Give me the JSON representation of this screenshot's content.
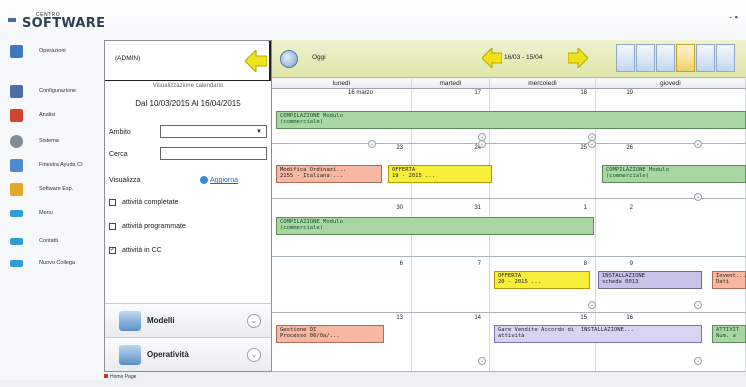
{
  "app": {
    "logo_line1": "CENTRO",
    "logo_line2": "SOFTWARE",
    "window_controls": "- ▪"
  },
  "nav": {
    "items": [
      {
        "label": "Operazioni",
        "icon": "stack-icon",
        "color": "#3e78c2"
      },
      {
        "label": "Configurazione",
        "icon": "tools-icon",
        "color": "#4c6ea8"
      },
      {
        "label": "Analisi",
        "icon": "chart-icon",
        "color": "#d0452e"
      },
      {
        "label": "Sistema",
        "icon": "gears-icon",
        "color": "#7f8c9a"
      },
      {
        "label": "Finestra Ayuda CI",
        "icon": "window-icon",
        "color": "#4d8ad1"
      },
      {
        "label": "Software Esp.",
        "icon": "box-icon",
        "color": "#e3a827"
      },
      {
        "label": "Menu",
        "icon": "arrow-icon",
        "color": "#2f9ed6"
      },
      {
        "label": "Contatti",
        "icon": "arrow-icon",
        "color": "#2f9ed6"
      },
      {
        "label": "Nuovo Collega",
        "icon": "arrow-icon",
        "color": "#2f9ed6"
      }
    ]
  },
  "panel": {
    "user": "(ADMIN)",
    "subtitle": "Visualizzazione calendario",
    "date_range": "Dal 10/03/2015 Al 16/04/2015",
    "ambito_label": "Ambito",
    "ambito_value": "",
    "cerca_label": "Cerca",
    "cerca_value": "",
    "visualizza_label": "Visualizza",
    "refresh_label": "Aggiorna",
    "checks": [
      {
        "label": "attività completate",
        "checked": false
      },
      {
        "label": "attività programmate",
        "checked": false
      },
      {
        "label": "attività in CC",
        "checked": true
      }
    ],
    "sections": [
      {
        "label": "Modelli",
        "icon": "document-icon"
      },
      {
        "label": "Operatività",
        "icon": "document-icon"
      }
    ]
  },
  "status": {
    "text": "Home Page"
  },
  "toolbar": {
    "today_label": "Oggi",
    "range_label": "16/03 - 15/04"
  },
  "calendar": {
    "days": [
      "lunedì",
      "martedì",
      "mercoledì",
      "giovedì"
    ],
    "weeks": [
      {
        "nums": [
          "16 marzo",
          "17",
          "18",
          "19"
        ]
      },
      {
        "nums": [
          "23",
          "24",
          "25",
          "26"
        ]
      },
      {
        "nums": [
          "30",
          "31",
          "1",
          "2"
        ]
      },
      {
        "nums": [
          "6",
          "7",
          "8",
          "9"
        ]
      },
      {
        "nums": [
          "13",
          "14",
          "15",
          "16"
        ]
      }
    ],
    "events": [
      {
        "text": "COMPILAZIONE Modulo\n(commerciale)",
        "style": "green"
      },
      {
        "text": "Modifica Ordinazi...\n2155 - Italiana ...",
        "style": "pink"
      },
      {
        "text": "OFFERTA\n19 - 2015 ...",
        "style": "yellow"
      },
      {
        "text": "COMPILAZIONE Modulo\n(commerciale)",
        "style": "green"
      },
      {
        "text": "COMPILAZIONE Modulo\n(commerciale)",
        "style": "green"
      },
      {
        "text": "OFFERTA\n20 - 2015 ...",
        "style": "yellow"
      },
      {
        "text": "INSTALLAZIONE\nscheda 0013",
        "style": "purple"
      },
      {
        "text": "Invent...\nDati",
        "style": "pink"
      },
      {
        "text": "Gestione DI\nProcesso 00/0a/...",
        "style": "pink"
      },
      {
        "text": "Gare Vendite Accordo di  INSTALLAZIONE...\nattività",
        "style": "purple-l"
      },
      {
        "text": "ATTIVIT\nNum. a",
        "style": "green"
      }
    ]
  }
}
